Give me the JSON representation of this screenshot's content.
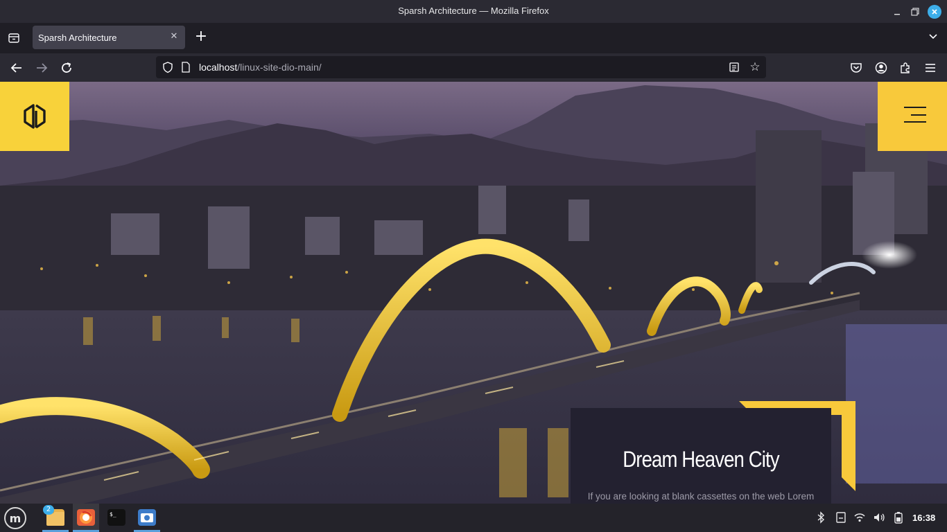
{
  "window": {
    "title": "Sparsh Architecture — Mozilla Firefox",
    "controls": [
      "minimize-icon",
      "maximize-icon",
      "close-icon"
    ]
  },
  "tabs": [
    {
      "label": "Sparsh Architecture",
      "active": true
    }
  ],
  "toolbar": {
    "new_tab_label": "+",
    "url_host": "localhost",
    "url_path": "/linux-site-dio-main/",
    "icons": [
      "back-icon",
      "forward-icon",
      "reload-icon",
      "shield-icon",
      "reader-icon",
      "star-icon",
      "pocket-icon",
      "account-icon",
      "extensions-icon",
      "menu-icon"
    ]
  },
  "page": {
    "accent_color": "#f8c93b",
    "card_color": "#232130",
    "caption": {
      "title": "Dream Heaven City",
      "text": "If you are looking at blank cassettes on the web Lorem"
    }
  },
  "taskbar": {
    "files_badge": "2",
    "apps": [
      "files-icon",
      "firefox-icon",
      "terminal-icon",
      "screenshot-icon"
    ],
    "tray_icons": [
      "bluetooth-icon",
      "notes-icon",
      "wifi-icon",
      "volume-icon",
      "battery-icon"
    ],
    "clock": "16:38"
  }
}
